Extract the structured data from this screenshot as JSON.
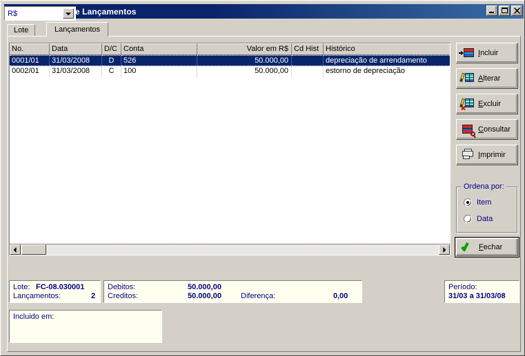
{
  "window": {
    "title": "Manutenção de Lançamentos",
    "icon": "ledger-pencil-icon",
    "caption_buttons": [
      {
        "name": "minimize-button",
        "label": "_"
      },
      {
        "name": "maximize-button",
        "label": "□"
      },
      {
        "name": "close-button",
        "label": "✕"
      }
    ]
  },
  "tabs": [
    {
      "label": "Lote",
      "active": false
    },
    {
      "label": "Lançamentos",
      "active": true
    }
  ],
  "grid": {
    "columns": [
      {
        "key": "no",
        "label": "No."
      },
      {
        "key": "data",
        "label": "Data"
      },
      {
        "key": "dc",
        "label": "D/C"
      },
      {
        "key": "conta",
        "label": "Conta"
      },
      {
        "key": "valor",
        "label": "Valor em R$"
      },
      {
        "key": "cdhist",
        "label": "Cd Hist"
      },
      {
        "key": "historico",
        "label": "Histórico"
      }
    ],
    "rows": [
      {
        "no": "0001/01",
        "data": "31/03/2008",
        "dc": "D",
        "conta": "526",
        "valor": "50.000,00",
        "cdhist": "",
        "historico": "depreciação de arrendamento",
        "selected": true
      },
      {
        "no": "0002/01",
        "data": "31/03/2008",
        "dc": "C",
        "conta": "100",
        "valor": "50.000,00",
        "cdhist": "",
        "historico": "estorno de depreciação",
        "selected": false
      }
    ]
  },
  "actions": [
    {
      "name": "incluir-button",
      "label_pre": "",
      "accel": "I",
      "label_post": "ncluir",
      "icon": "table-insert-icon"
    },
    {
      "name": "alterar-button",
      "label_pre": "",
      "accel": "A",
      "label_post": "lterar",
      "icon": "table-edit-icon"
    },
    {
      "name": "excluir-button",
      "label_pre": "",
      "accel": "E",
      "label_post": "xcluir",
      "icon": "table-delete-icon"
    },
    {
      "name": "consultar-button",
      "label_pre": "",
      "accel": "C",
      "label_post": "onsultar",
      "icon": "table-search-icon"
    },
    {
      "name": "imprimir-button",
      "label_pre": "",
      "accel": "I",
      "label_post": "mprimir",
      "icon": "printer-icon"
    }
  ],
  "order_group": {
    "title": "Ordena por:",
    "options": [
      {
        "label": "Item",
        "checked": true
      },
      {
        "label": "Data",
        "checked": false
      }
    ]
  },
  "close_button": {
    "accel": "F",
    "label_post": "echar",
    "icon": "green-check-icon"
  },
  "summary": {
    "lote_label": "Lote:",
    "lote_value": "FC-08.030001",
    "lancamentos_label": "Lançamentos:",
    "lancamentos_value": "2",
    "debitos_label": "Debitos:",
    "debitos_value": "50.000,00",
    "creditos_label": "Creditos:",
    "creditos_value": "50.000,00",
    "diferenca_label": "Diferença:",
    "diferenca_value": "0,00",
    "currency_value": "R$",
    "periodo_label": "Período:",
    "periodo_value": "31/03 a 31/03/08",
    "incluido_label": "Incluido em:"
  },
  "scrollbar": {
    "left_arrow": "scroll-left-arrow",
    "right_arrow": "scroll-right-arrow"
  },
  "colors": {
    "titlebar_start": "#0a246a",
    "titlebar_end": "#3a6ea5",
    "face": "#d4d0c8",
    "selection": "#0a246a",
    "info_bg": "#fffff0",
    "info_text": "#000080"
  }
}
